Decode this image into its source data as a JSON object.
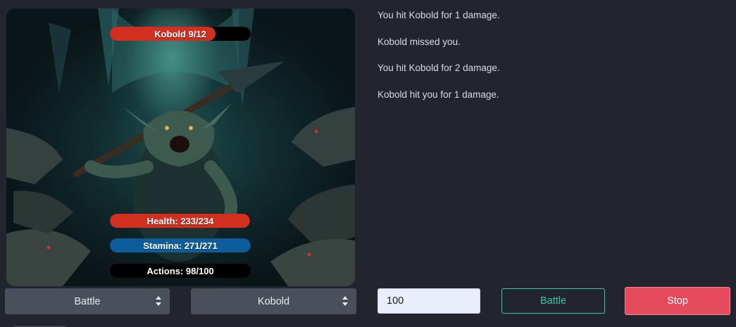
{
  "enemy_bar": {
    "label": "Kobold 9/12",
    "fraction": 0.75,
    "color": "#d32f21"
  },
  "player": {
    "health": {
      "label": "Health: 233/234",
      "fraction": 0.996,
      "color": "#d32f21"
    },
    "stamina": {
      "label": "Stamina: 271/271",
      "fraction": 1.0,
      "color": "#0b5d9c"
    },
    "actions": {
      "label": "Actions: 98/100",
      "fraction": 0.98,
      "color": "#000000"
    }
  },
  "log": [
    "You hit Kobold for 1 damage.",
    "Kobold missed you.",
    "You hit Kobold for 2 damage.",
    "Kobold hit you for 1 damage."
  ],
  "controls": {
    "mode_select": "Battle",
    "enemy_select": "Kobold",
    "count_input": "100",
    "battle_button": "Battle",
    "stop_button": "Stop"
  },
  "colors": {
    "background": "#22252e",
    "accent_teal": "#3cc6a5",
    "stop_red": "#e54b5c"
  }
}
